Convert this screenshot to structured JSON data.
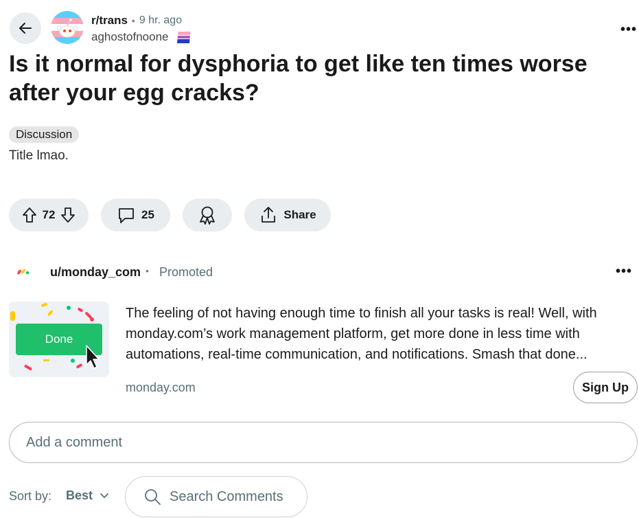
{
  "post": {
    "subreddit": "r/trans",
    "time": "9 hr. ago",
    "author": "aghostofnoone",
    "title": "Is it normal for dysphoria to get like ten times worse after your egg cracks?",
    "flair": "Discussion",
    "body": "Title lmao.",
    "upvotes": "72",
    "comments": "25",
    "share_label": "Share"
  },
  "ad": {
    "user": "u/monday_com",
    "promoted_label": "Promoted",
    "thumb_button_label": "Done",
    "text": "The feeling of not having enough time to finish all your tasks is real! Well, with monday.com’s work management platform, get more done in less time with automations, real-time communication, and notifications. Smash that done...",
    "domain": "monday.com",
    "cta_label": "Sign Up"
  },
  "comment_box": {
    "placeholder": "Add a comment"
  },
  "sort": {
    "label": "Sort by:",
    "value": "Best"
  },
  "search": {
    "placeholder": "Search Comments"
  },
  "colors": {
    "pill_bg": "#e9edef",
    "monday_green": "#1fbf6b",
    "text_secondary": "#576f76"
  },
  "icons": [
    "back-arrow-icon",
    "subreddit-avatar-icon",
    "trans-flag-icon",
    "more-icon",
    "upvote-icon",
    "downvote-icon",
    "comment-icon",
    "award-icon",
    "share-icon",
    "monday-logo-icon",
    "cursor-icon",
    "chevron-down-icon",
    "search-icon"
  ]
}
